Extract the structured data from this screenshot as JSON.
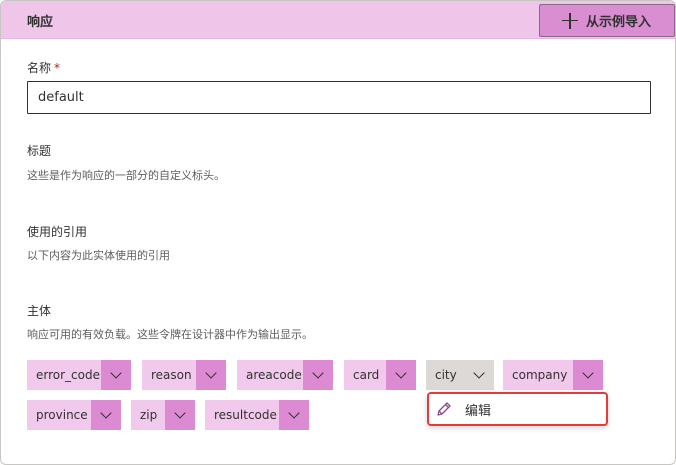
{
  "header": {
    "title": "响应",
    "import_button": "从示例导入"
  },
  "name_field": {
    "label": "名称",
    "required_mark": "*",
    "value": "default"
  },
  "headers_section": {
    "title": "标题",
    "description": "这些是作为响应的一部分的自定义标头。"
  },
  "references_section": {
    "title": "使用的引用",
    "description": "以下内容为此实体使用的引用"
  },
  "body_section": {
    "title": "主体",
    "description": "响应可用的有效负载。这些令牌在设计器中作为输出显示。",
    "tokens": [
      "error_code",
      "reason",
      "areacode",
      "card",
      "city",
      "company",
      "province",
      "zip",
      "resultcode"
    ]
  },
  "context_menu": {
    "edit_label": "编辑",
    "icon": "pencil-icon"
  },
  "colors": {
    "header_bg": "#efc5ea",
    "token_label_bg": "#f1c9ec",
    "token_chevron_bg": "#dc8bd3",
    "token_plain_bg": "#dcd9d6",
    "highlight_border": "#e23b3b"
  }
}
